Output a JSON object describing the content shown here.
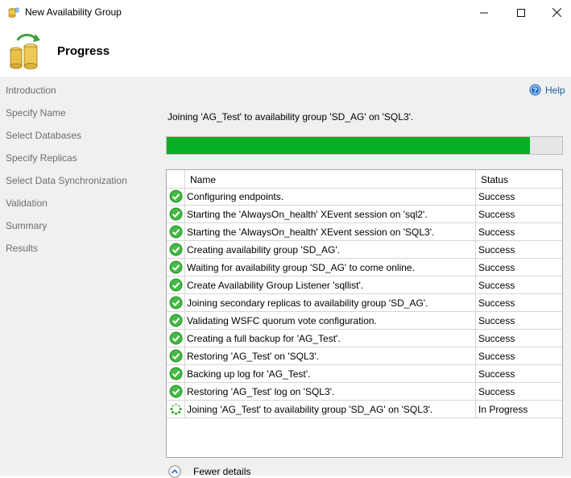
{
  "window": {
    "title": "New Availability Group"
  },
  "header": {
    "title": "Progress"
  },
  "sidebar": {
    "items": [
      {
        "label": "Introduction"
      },
      {
        "label": "Specify Name"
      },
      {
        "label": "Select Databases"
      },
      {
        "label": "Specify Replicas"
      },
      {
        "label": "Select Data Synchronization"
      },
      {
        "label": "Validation"
      },
      {
        "label": "Summary"
      },
      {
        "label": "Results"
      }
    ]
  },
  "help": {
    "label": "Help",
    "icon": "help-icon"
  },
  "main": {
    "status_message": "Joining 'AG_Test' to availability group 'SD_AG' on 'SQL3'.",
    "progress": {
      "fraction": 0.918,
      "color": "#06b025"
    },
    "grid": {
      "columns": {
        "name": "Name",
        "status": "Status"
      },
      "rows": [
        {
          "name": "Configuring endpoints.",
          "status": "Success",
          "state": "success"
        },
        {
          "name": "Starting the 'AlwaysOn_health' XEvent session on 'sql2'.",
          "status": "Success",
          "state": "success"
        },
        {
          "name": "Starting the 'AlwaysOn_health' XEvent session on 'SQL3'.",
          "status": "Success",
          "state": "success"
        },
        {
          "name": "Creating availability group 'SD_AG'.",
          "status": "Success",
          "state": "success"
        },
        {
          "name": "Waiting for availability group 'SD_AG' to come online.",
          "status": "Success",
          "state": "success"
        },
        {
          "name": "Create Availability Group Listener 'sqllist'.",
          "status": "Success",
          "state": "success"
        },
        {
          "name": "Joining secondary replicas to availability group 'SD_AG'.",
          "status": "Success",
          "state": "success"
        },
        {
          "name": "Validating WSFC quorum vote configuration.",
          "status": "Success",
          "state": "success"
        },
        {
          "name": "Creating a full backup for 'AG_Test'.",
          "status": "Success",
          "state": "success"
        },
        {
          "name": "Restoring 'AG_Test' on 'SQL3'.",
          "status": "Success",
          "state": "success"
        },
        {
          "name": "Backing up log for 'AG_Test'.",
          "status": "Success",
          "state": "success"
        },
        {
          "name": "Restoring 'AG_Test' log on 'SQL3'.",
          "status": "Success",
          "state": "success"
        },
        {
          "name": "Joining 'AG_Test' to availability group 'SD_AG' on 'SQL3'.",
          "status": "In Progress",
          "state": "in-progress"
        }
      ]
    },
    "details_toggle": {
      "label": "Fewer details"
    }
  }
}
